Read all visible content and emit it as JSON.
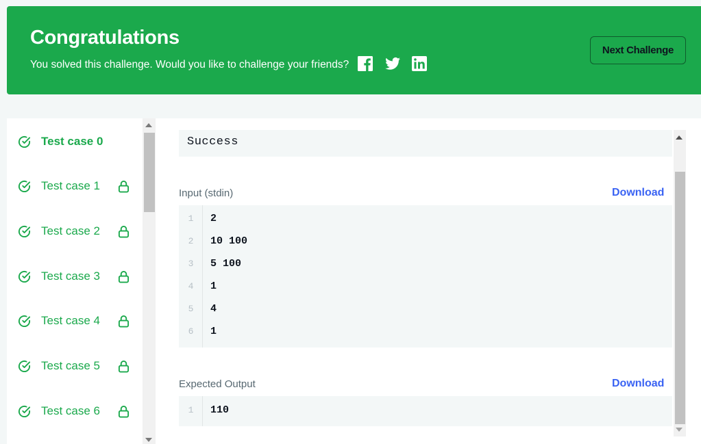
{
  "banner": {
    "title": "Congratulations",
    "message": "You solved this challenge. Would you like to challenge your friends?",
    "share": [
      "facebook-icon",
      "twitter-icon",
      "linkedin-icon"
    ],
    "next_label": "Next Challenge"
  },
  "test_cases": [
    {
      "label": "Test case 0",
      "active": true,
      "locked": false
    },
    {
      "label": "Test case 1",
      "active": false,
      "locked": true
    },
    {
      "label": "Test case 2",
      "active": false,
      "locked": true
    },
    {
      "label": "Test case 3",
      "active": false,
      "locked": true
    },
    {
      "label": "Test case 4",
      "active": false,
      "locked": true
    },
    {
      "label": "Test case 5",
      "active": false,
      "locked": true
    },
    {
      "label": "Test case 6",
      "active": false,
      "locked": true
    }
  ],
  "result": {
    "status": "Success",
    "input": {
      "title": "Input (stdin)",
      "download_label": "Download",
      "lines": [
        {
          "n": "1",
          "text": "2"
        },
        {
          "n": "2",
          "text": "10 100"
        },
        {
          "n": "3",
          "text": "5 100"
        },
        {
          "n": "4",
          "text": "1"
        },
        {
          "n": "5",
          "text": "4"
        },
        {
          "n": "6",
          "text": "1"
        }
      ]
    },
    "expected": {
      "title": "Expected Output",
      "download_label": "Download",
      "lines": [
        {
          "n": "1",
          "text": "110"
        }
      ]
    }
  },
  "colors": {
    "accent_green": "#1ba94c",
    "link_blue": "#3a63f3",
    "text_dark": "#0e141e",
    "code_bg": "#f3f7f7"
  }
}
